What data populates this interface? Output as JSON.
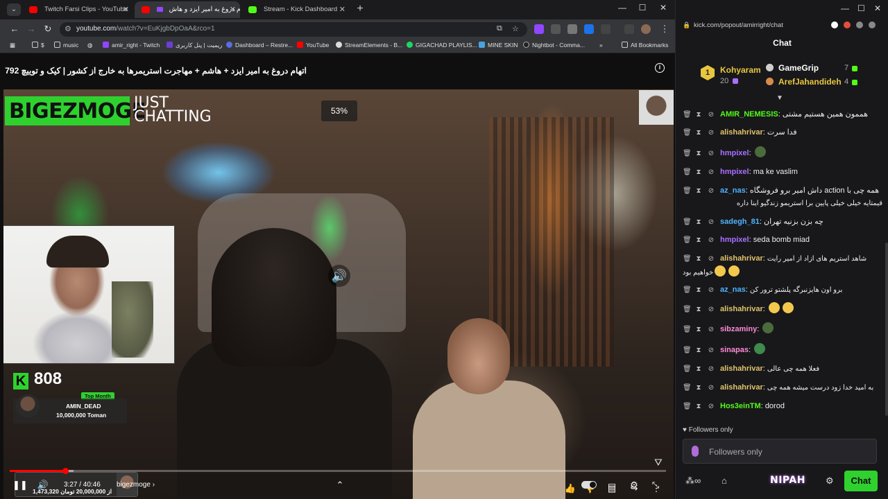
{
  "browser": {
    "tabs": [
      {
        "title": "Twitch Farsi Clips - YouTube",
        "active": false
      },
      {
        "title": "اتهام دروغ به امیر ایزد و هاش",
        "active": true
      },
      {
        "title": "Stream - Kick Dashboard",
        "active": false
      }
    ],
    "url_host": "youtube.com",
    "url_path": "/watch?v=EuKjgbDpOaA&rco=1",
    "bookmarks": [
      "$",
      "music",
      "amir_right - Twitch",
      "ریمیت | پنل کاربری",
      "Dashboard – Restre...",
      "YouTube",
      "StreamElements - B...",
      "GIGACHAD PLAYLIS...",
      "MINE SKIN",
      "Nightbot - Comma..."
    ],
    "all_bookmarks": "All Bookmarks"
  },
  "video": {
    "title": "اتهام دروغ به امیر ایزد + هاشم + مهاجرت استریمرها به خارج از کشور | کیک و توییچ 792",
    "overlay_brand": "BIGEZMOGE",
    "overlay_category_1": "JUST",
    "overlay_category_2": "CHATTING",
    "percent_badge": "53%",
    "kick_followers": "808",
    "top_month_label": "Top Month",
    "top_month_user": "AMIN_DEAD",
    "top_month_amount": "10,000,000 Toman",
    "goal_text": "1,473,320 از 20,000,000 تومان",
    "progress_fraction": 0.085,
    "time_display": "3:27 / 40:46",
    "chapter": "bigezmoge",
    "chapter_arrow": "›"
  },
  "chat": {
    "url": "kick.com/popout/amirright/chat",
    "header": "Chat",
    "leaderboard": {
      "first_name": "Kohyaram",
      "first_rank": "1",
      "first_count": "20",
      "second_name": "GameGrip",
      "second_count": "7",
      "third_name": "ArefJahandideh",
      "third_count": "4"
    },
    "messages": [
      {
        "user": "AMIR_NEMESIS",
        "color": "#53fc18",
        "text": "هممون همین هستیم مشتی"
      },
      {
        "user": "alishahrivar",
        "color": "#e0c36a",
        "text": "فدا سرت"
      },
      {
        "user": "hmpixel",
        "color": "#a970ff",
        "text": ""
      },
      {
        "user": "hmpixel",
        "color": "#a970ff",
        "text": "ma ke vaslim"
      },
      {
        "user": "az_nas",
        "color": "#4fb3ff",
        "text": "همه چی با action داش امیر برو فروشگاه"
      },
      {
        "user": "",
        "color": "",
        "text": "قیمتایه خیلی خیلی پایین برا استریمو زندگیو اینا داره"
      },
      {
        "user": "sadegh_81",
        "color": "#4fb3ff",
        "text": "چه بزن بزنیه تهران"
      },
      {
        "user": "hmpixel",
        "color": "#a970ff",
        "text": "seda bomb miad"
      },
      {
        "user": "alishahrivar",
        "color": "#e0c36a",
        "text": "شاهد استریم های ازاد از امیر رایت"
      },
      {
        "user": "",
        "color": "",
        "text": "خواهیم بود"
      },
      {
        "user": "az_nas",
        "color": "#4fb3ff",
        "text": "برو اون هایزنبرگه پلشتو ترور کن"
      },
      {
        "user": "alishahrivar",
        "color": "#e0c36a",
        "text": ""
      },
      {
        "user": "sibzaminy",
        "color": "#ff8ad8",
        "text": ""
      },
      {
        "user": "sinapas",
        "color": "#ff8ad8",
        "text": ""
      },
      {
        "user": "alishahrivar",
        "color": "#e0c36a",
        "text": "فعلا همه چی عالی"
      },
      {
        "user": "alishahrivar",
        "color": "#e0c36a",
        "text": "به امید خدا زود درست میشه همه چی"
      },
      {
        "user": "Hos3einTM",
        "color": "#53fc18",
        "text": "dorod"
      }
    ],
    "followers_label": "Followers only",
    "input_placeholder": "Followers only",
    "nipah": "NIPAH",
    "chat_button": "Chat"
  }
}
